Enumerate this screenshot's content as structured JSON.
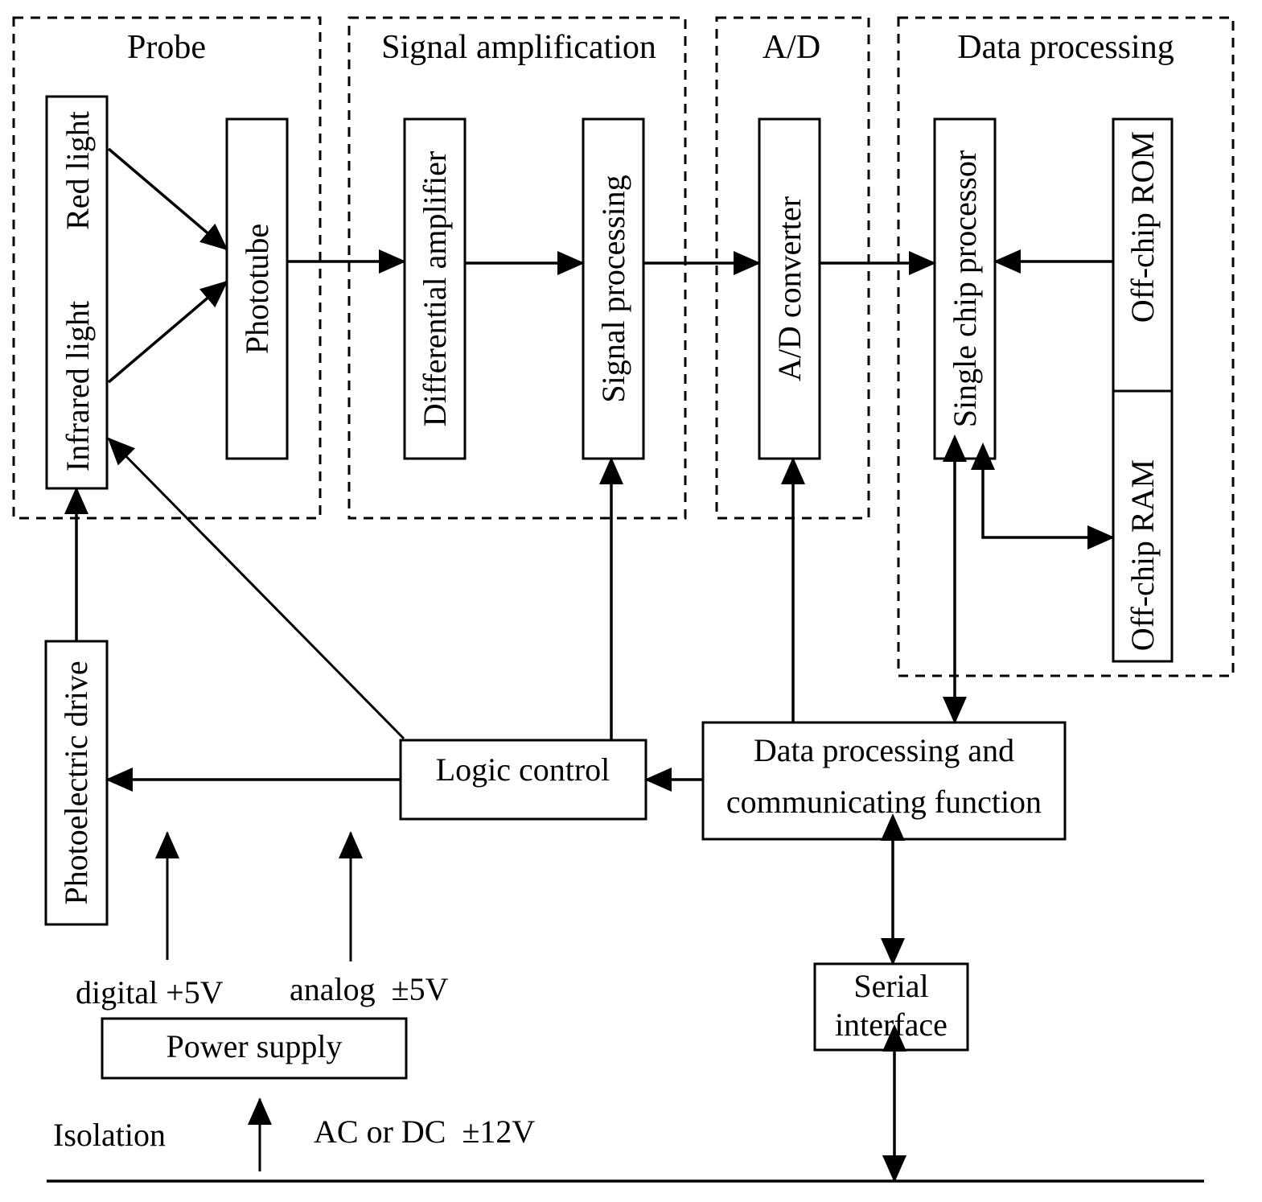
{
  "groups": {
    "probe": "Probe",
    "signal_amplification": "Signal amplification",
    "ad": "A/D",
    "data_processing": "Data processing"
  },
  "blocks": {
    "red_light": "Red light",
    "infrared_light": "Infrared light",
    "phototube": "Phototube",
    "differential_amplifier": "Differential amplifier",
    "signal_processing": "Signal processing",
    "ad_converter": "A/D converter",
    "single_chip_processor": "Single chip processor",
    "off_chip_rom": "Off-chip ROM",
    "off_chip_ram": "Off-chip RAM",
    "photoelectric_drive": "Photoelectric drive",
    "logic_control": "Logic control",
    "data_comm_line1": "Data processing and",
    "data_comm_line2": "communicating function",
    "serial_line1": "Serial",
    "serial_line2": "interface",
    "power_supply": "Power supply"
  },
  "labels": {
    "digital": "digital +5V",
    "analog": "analog  ±5V",
    "isolation": "Isolation",
    "ac_dc": "AC or DC  ±12V"
  }
}
